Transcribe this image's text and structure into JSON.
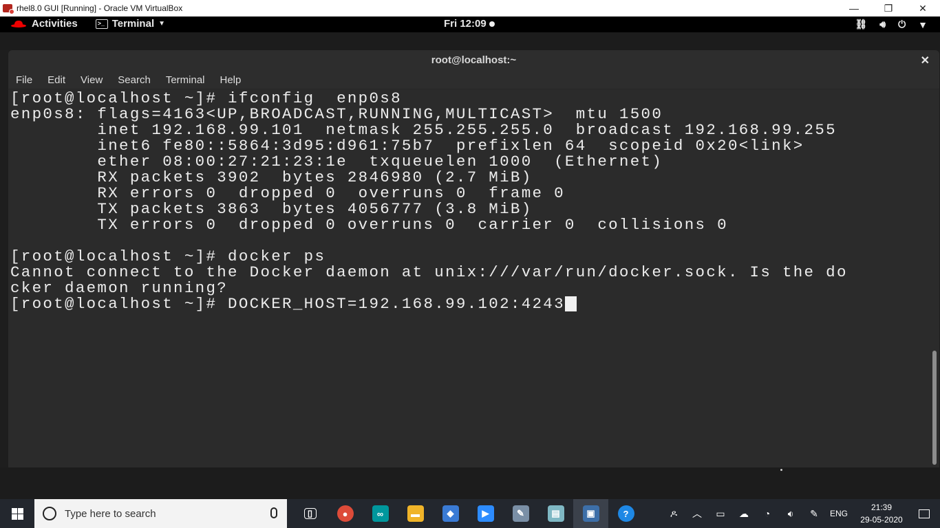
{
  "vbox": {
    "title": "rhel8.0 GUI [Running] - Oracle VM VirtualBox",
    "minimize": "—",
    "restore": "❐",
    "close": "✕"
  },
  "gnome": {
    "activities": "Activities",
    "app_menu": "Terminal",
    "clock": "Fri 12:09"
  },
  "terminal": {
    "title": "root@localhost:~",
    "close": "✕",
    "menu": [
      "File",
      "Edit",
      "View",
      "Search",
      "Terminal",
      "Help"
    ],
    "lines": [
      "[root@localhost ~]# ifconfig  enp0s8",
      "enp0s8: flags=4163<UP,BROADCAST,RUNNING,MULTICAST>  mtu 1500",
      "        inet 192.168.99.101  netmask 255.255.255.0  broadcast 192.168.99.255",
      "        inet6 fe80::5864:3d95:d961:75b7  prefixlen 64  scopeid 0x20<link>",
      "        ether 08:00:27:21:23:1e  txqueuelen 1000  (Ethernet)",
      "        RX packets 3902  bytes 2846980 (2.7 MiB)",
      "        RX errors 0  dropped 0  overruns 0  frame 0",
      "        TX packets 3863  bytes 4056777 (3.8 MiB)",
      "        TX errors 0  dropped 0 overruns 0  carrier 0  collisions 0",
      "",
      "[root@localhost ~]# docker ps",
      "Cannot connect to the Docker daemon at unix:///var/run/docker.sock. Is the do",
      "cker daemon running?",
      "[root@localhost ~]# DOCKER_HOST=192.168.99.102:4243"
    ]
  },
  "taskbar": {
    "search_placeholder": "Type here to search",
    "apps": [
      {
        "name": "task-view",
        "glyph": "▯",
        "color": "#23272e"
      },
      {
        "name": "chrome",
        "glyph": "●",
        "color": "#dd4b39"
      },
      {
        "name": "arduino",
        "glyph": "∞",
        "color": "#00979d"
      },
      {
        "name": "file-explorer",
        "glyph": "▬",
        "color": "#f0b429"
      },
      {
        "name": "app-blue",
        "glyph": "◆",
        "color": "#3a7bd5"
      },
      {
        "name": "zoom",
        "glyph": "▶",
        "color": "#2d8cff"
      },
      {
        "name": "paint",
        "glyph": "✎",
        "color": "#7a8fa6"
      },
      {
        "name": "notes",
        "glyph": "▤",
        "color": "#7fb8c4"
      },
      {
        "name": "virtualbox",
        "glyph": "▣",
        "color": "#3d6fa8"
      },
      {
        "name": "help",
        "glyph": "?",
        "color": "#1e88e5"
      }
    ],
    "lang": "ENG",
    "time": "21:39",
    "date": "29-05-2020"
  }
}
